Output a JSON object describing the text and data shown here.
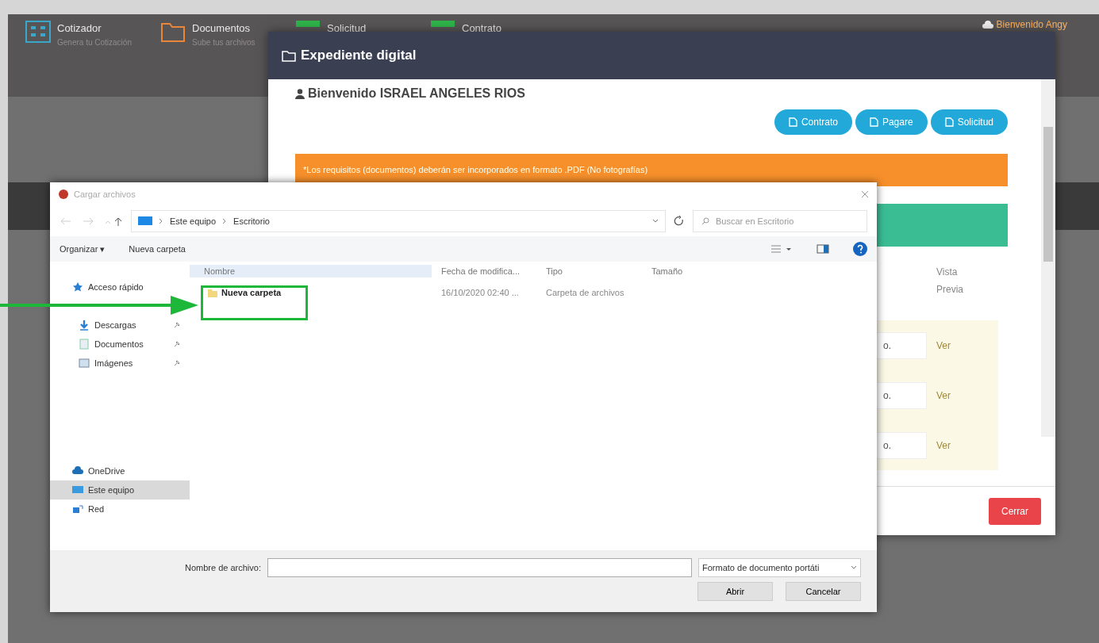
{
  "nav": {
    "items": [
      {
        "title": "Cotizador",
        "subtitle": "Genera tu Cotización",
        "color": "#3aa6c9"
      },
      {
        "title": "Documentos",
        "subtitle": "Sube tus archivos",
        "color": "#e8873a"
      },
      {
        "title": "Solicitud",
        "color": "#2fb34a"
      },
      {
        "title": "Contrato",
        "color": "#2fb34a"
      }
    ],
    "user": "Bienvenido Angy"
  },
  "modal": {
    "title": "Expediente digital",
    "welcome": "Bienvenido ISRAEL ANGELES RIOS",
    "buttons": [
      "Contrato",
      "Pagare",
      "Solicitud"
    ],
    "notice": "*Los requisitos (documentos) deberán ser incorporados en formato .PDF (No fotografías)",
    "table": {
      "columns": [
        "Vista Previa"
      ],
      "rows": [
        {
          "file": "o.",
          "preview": "Ver"
        },
        {
          "file": "o.",
          "preview": "Ver"
        },
        {
          "file": "o.",
          "preview": "Ver"
        }
      ]
    },
    "close": "Cerrar"
  },
  "dialog": {
    "title": "Cargar archivos",
    "path": [
      "Este equipo",
      "Escritorio"
    ],
    "search_placeholder": "Buscar en Escritorio",
    "toolbar": {
      "organize": "Organizar ▾",
      "new_folder": "Nueva carpeta"
    },
    "sidebar": [
      {
        "label": "Acceso rápido",
        "kind": "star",
        "selected": false,
        "children": [
          {
            "label": "Descargas",
            "kind": "download",
            "selected": false,
            "pinned": true
          },
          {
            "label": "Documentos",
            "kind": "document",
            "selected": false,
            "pinned": true
          },
          {
            "label": "Imágenes",
            "kind": "image",
            "selected": false,
            "pinned": true
          }
        ]
      },
      {
        "label": "OneDrive",
        "kind": "cloud",
        "selected": false
      },
      {
        "label": "Este equipo",
        "kind": "computer",
        "selected": true
      },
      {
        "label": "Red",
        "kind": "network",
        "selected": false
      }
    ],
    "columns": [
      "Nombre",
      "Fecha de modifica...",
      "Tipo",
      "Tamaño"
    ],
    "files": [
      {
        "name": "Nueva carpeta",
        "date": "16/10/2020 02:40 ...",
        "type": "Carpeta de archivos"
      }
    ],
    "filename_label": "Nombre de archivo:",
    "file_type": "Formato de documento portáti",
    "buttons": [
      "Abrir",
      "Cancelar"
    ]
  }
}
